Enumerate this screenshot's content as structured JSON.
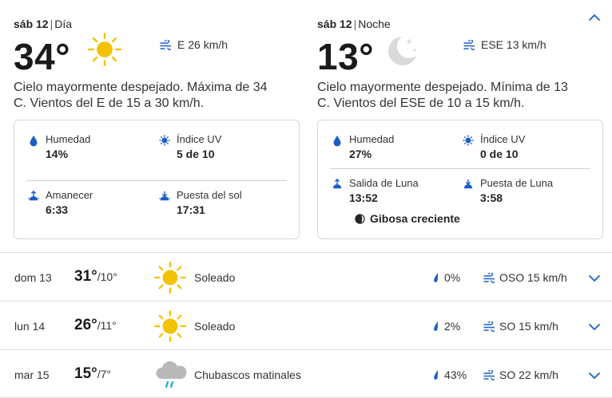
{
  "day": {
    "date": "sáb 12",
    "period": "Día",
    "temp": "34°",
    "wind": "E 26 km/h",
    "description": "Cielo mayormente despejado. Máxima de 34 C. Vientos del E de 15 a 30 km/h.",
    "details": {
      "humidity_label": "Humedad",
      "humidity_value": "14%",
      "uv_label": "Índice UV",
      "uv_value": "5 de 10",
      "sunrise_label": "Amanecer",
      "sunrise_value": "6:33",
      "sunset_label": "Puesta del sol",
      "sunset_value": "17:31"
    }
  },
  "night": {
    "date": "sáb 12",
    "period": "Noche",
    "temp": "13°",
    "wind": "ESE 13 km/h",
    "description": "Cielo mayormente despejado. Mínima de 13 C. Vientos del ESE de 10 a 15 km/h.",
    "details": {
      "humidity_label": "Humedad",
      "humidity_value": "27%",
      "uv_label": "Índice UV",
      "uv_value": "0 de 10",
      "moonrise_label": "Salida de Luna",
      "moonrise_value": "13:52",
      "moonset_label": "Puesta de Luna",
      "moonset_value": "3:58",
      "moon_phase": "Gibosa creciente"
    }
  },
  "forecast": [
    {
      "date": "dom 13",
      "high": "31°",
      "low": "/10°",
      "condition": "Soleado",
      "icon": "sun-icon",
      "rain": "0%",
      "wind": "OSO 15 km/h"
    },
    {
      "date": "lun 14",
      "high": "26°",
      "low": "/11°",
      "condition": "Soleado",
      "icon": "sun-icon",
      "rain": "2%",
      "wind": "SO 15 km/h"
    },
    {
      "date": "mar 15",
      "high": "15°",
      "low": "/7°",
      "condition": "Chubascos matinales",
      "icon": "rain-cloud-icon",
      "rain": "43%",
      "wind": "SO 22 km/h"
    }
  ],
  "colors": {
    "accent": "#1b5fc6",
    "sun": "#f2c200",
    "moon": "#d9d9d9"
  }
}
